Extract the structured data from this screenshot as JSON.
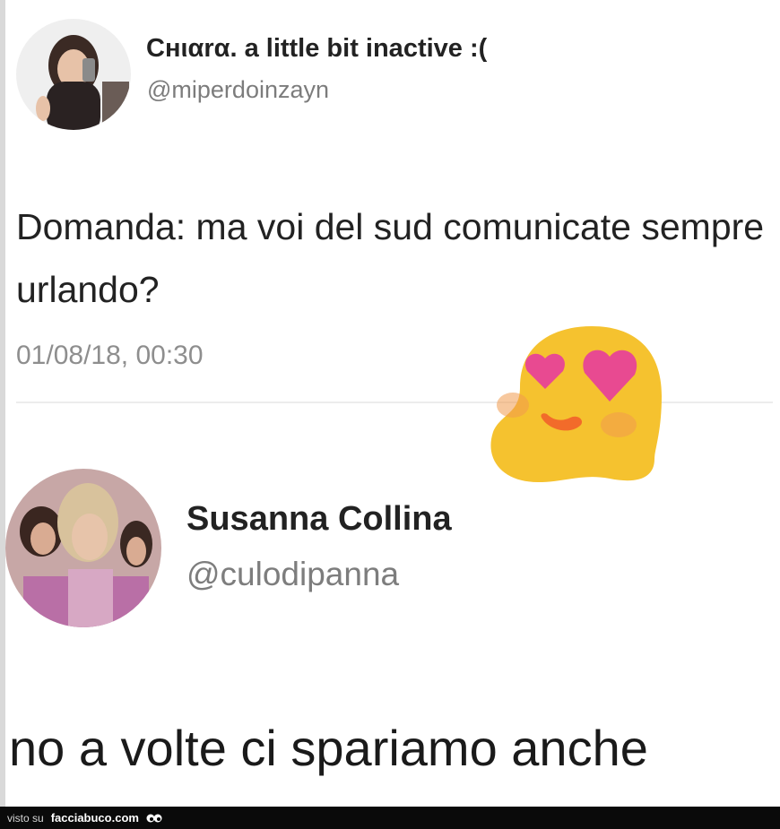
{
  "tweet": {
    "author_name": "Cнιαrα. a little bit inactive :(",
    "author_handle": "@miperdoinzayn",
    "text": "Domanda: ma voi del sud comunicate sempre urlando?",
    "timestamp": "01/08/18, 00:30"
  },
  "reply": {
    "author_name": "Susanna Collina",
    "author_handle": "@culodipanna",
    "text": "no a volte ci spariamo anche"
  },
  "sticker": {
    "icon": "heart-eyes-emoji-icon"
  },
  "footer": {
    "prefix": "visto su",
    "site": "facciabuco.com",
    "logo_icon": "eyes-logo-icon"
  },
  "colors": {
    "text_primary": "#222222",
    "text_secondary": "#7c7c7c",
    "emoji_yellow": "#f5c22f",
    "heart_pink": "#e84a91",
    "footer_bg": "#0a0a0a"
  }
}
